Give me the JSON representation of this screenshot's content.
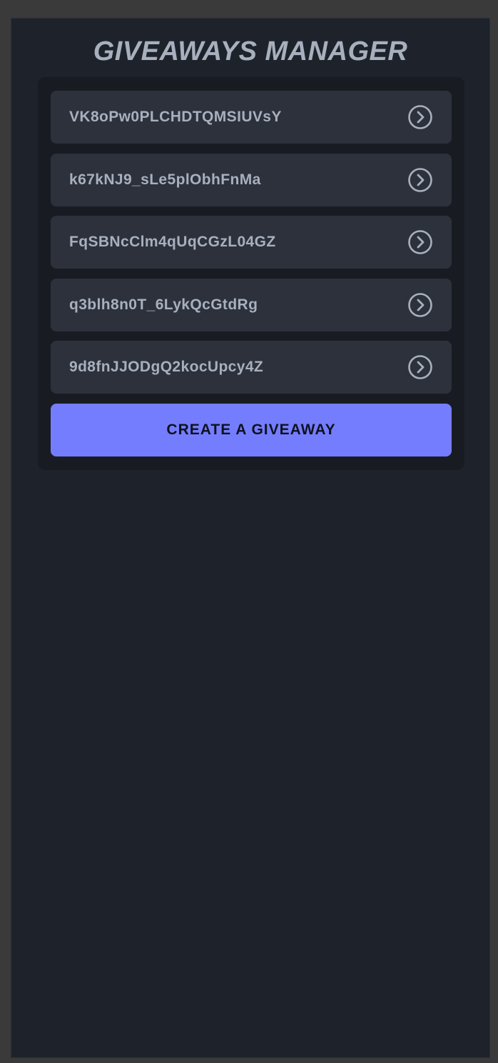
{
  "page": {
    "title": "GIVEAWAYS MANAGER"
  },
  "giveaways": {
    "items": [
      {
        "label": "VK8oPw0PLCHDTQMSIUVsY",
        "icon": "chevron-right-circle-icon"
      },
      {
        "label": "k67kNJ9_sLe5plObhFnMa",
        "icon": "chevron-right-circle-icon"
      },
      {
        "label": "FqSBNcClm4qUqCGzL04GZ",
        "icon": "chevron-right-circle-icon"
      },
      {
        "label": "q3blh8n0T_6LykQcGtdRg",
        "icon": "chevron-right-circle-icon"
      },
      {
        "label": "9d8fnJJODgQ2kocUpcy4Z",
        "icon": "chevron-right-circle-icon"
      }
    ],
    "create_label": "CREATE A GIVEAWAY"
  },
  "colors": {
    "background": "#1e232b",
    "panel": "#181c22",
    "item": "#2c313c",
    "text": "#a8b0be",
    "accent": "#757dff"
  }
}
